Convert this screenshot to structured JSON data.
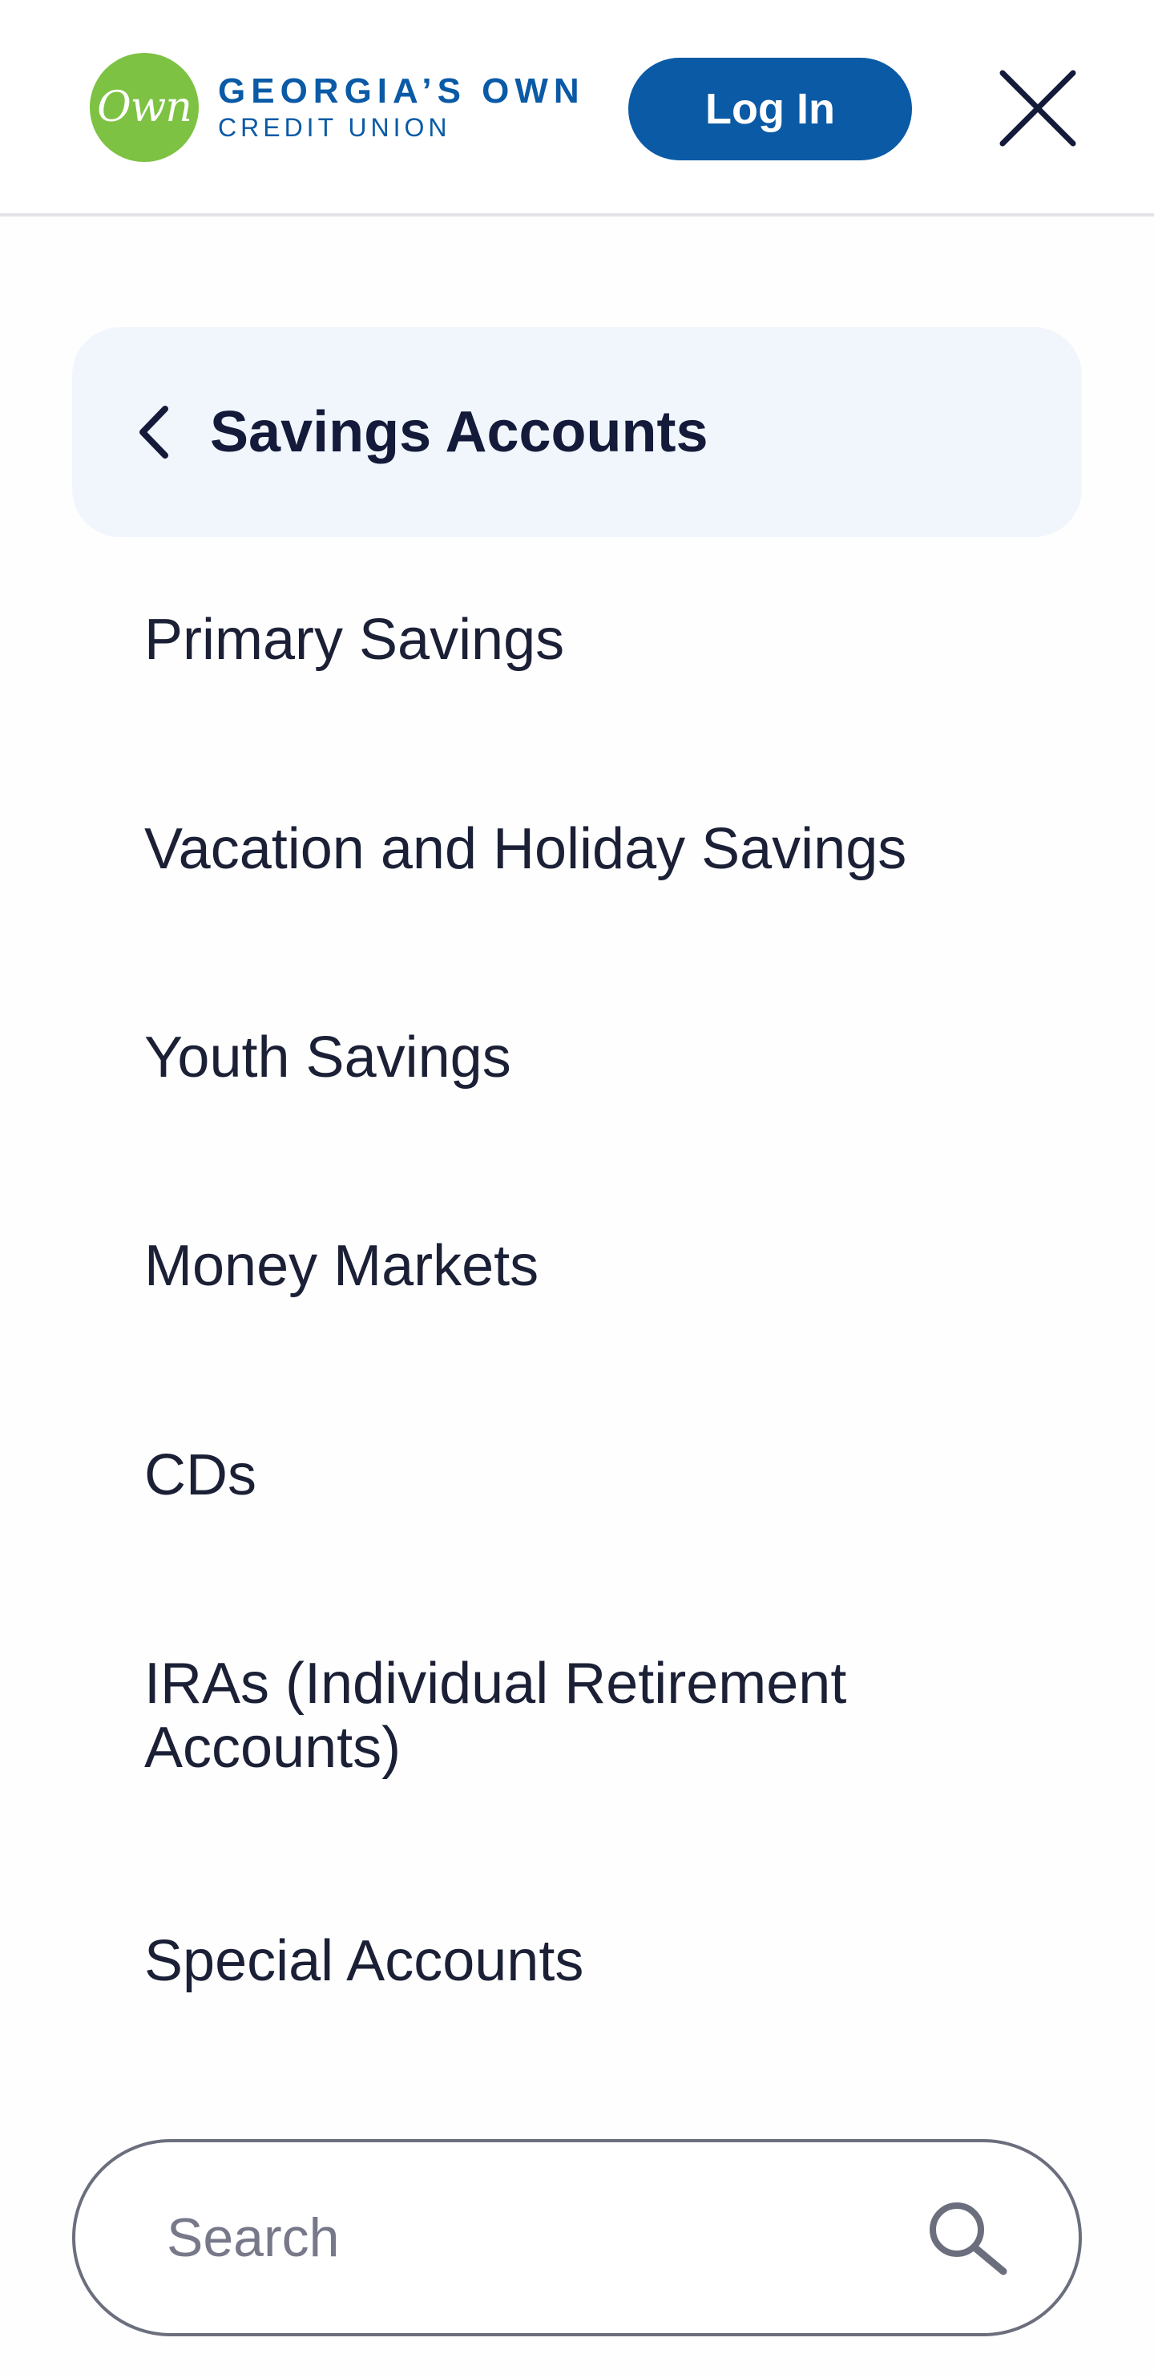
{
  "header": {
    "logo": {
      "mark_text": "Own",
      "line1": "GEORGIA’S OWN",
      "line2": "CREDIT UNION",
      "mark_color": "#7dc242",
      "text_color": "#0a5aa6"
    },
    "login_label": "Log In",
    "close_icon": "close-icon"
  },
  "submenu": {
    "back_icon": "chevron-left-icon",
    "title": "Savings Accounts",
    "items": [
      {
        "label": "Primary Savings"
      },
      {
        "label": "Vacation and Holiday Savings"
      },
      {
        "label": "Youth Savings"
      },
      {
        "label": "Money Markets"
      },
      {
        "label": "CDs"
      },
      {
        "label": "IRAs (Individual Retirement Accounts)"
      },
      {
        "label": "Special Accounts"
      }
    ]
  },
  "search": {
    "placeholder": "Search",
    "value": "",
    "icon": "search-icon"
  },
  "colors": {
    "brand_blue": "#0a5aa6",
    "brand_green": "#7dc242",
    "panel_bg": "#f1f6fd",
    "text_dark": "#1b2036"
  }
}
